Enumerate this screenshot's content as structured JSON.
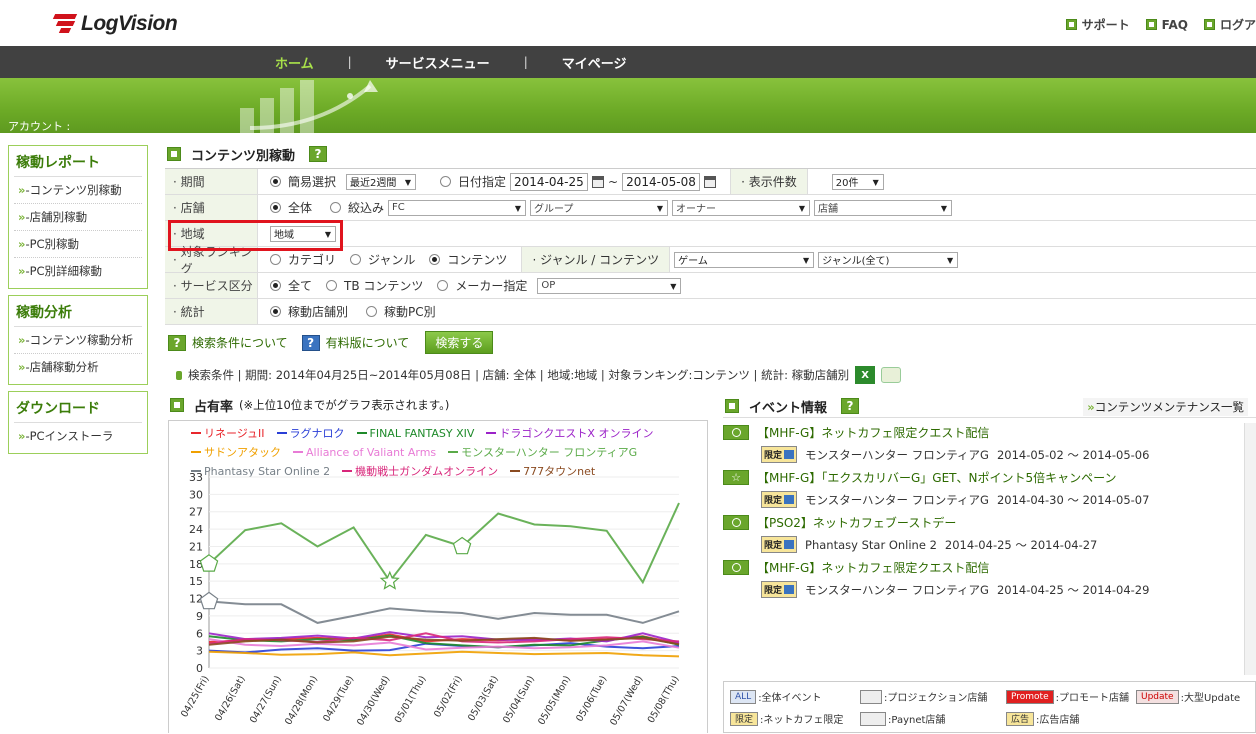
{
  "app": {
    "logo": "LogVision"
  },
  "toplinks": [
    {
      "label": "サポート"
    },
    {
      "label": "FAQ"
    },
    {
      "label": "ログア"
    }
  ],
  "nav": {
    "items": [
      "ホーム",
      "サービスメニュー",
      "マイページ"
    ],
    "sep": "|",
    "active": 0
  },
  "account_label": "アカウント :",
  "sidebar": [
    {
      "title": "稼動レポート",
      "items": [
        "-コンテンツ別稼動",
        "-店舗別稼動",
        "-PC別稼動",
        "-PC別詳細稼動"
      ]
    },
    {
      "title": "稼動分析",
      "items": [
        "-コンテンツ稼動分析",
        "-店舗稼動分析"
      ]
    },
    {
      "title": "ダウンロード",
      "items": [
        "-PCインストーラ"
      ]
    }
  ],
  "page_title": "コンテンツ別稼動",
  "form": {
    "period": {
      "label": "期間",
      "simple": "簡易選択",
      "simple_value": "最近2週間",
      "date_label": "日付指定",
      "from": "2014-04-25",
      "tilde": "~",
      "to": "2014-05-08",
      "count_label": "表示件数",
      "count_value": "20件"
    },
    "store": {
      "label": "店舗",
      "all": "全体",
      "filter": "絞込み",
      "s1": "FC",
      "s2": "グループ",
      "s3": "オーナー",
      "s4": "店舗"
    },
    "region": {
      "label": "地域",
      "value": "地域"
    },
    "ranking": {
      "label": "対象ランキング",
      "o1": "カテゴリ",
      "o2": "ジャンル",
      "o3": "コンテンツ",
      "sub_label": "ジャンル / コンテンツ",
      "s1": "ゲーム",
      "s2": "ジャンル(全て)"
    },
    "service": {
      "label": "サービス区分",
      "o1": "全て",
      "o2": "TB コンテンツ",
      "o3": "メーカー指定",
      "s1": "OP"
    },
    "stats": {
      "label": "統計",
      "o1": "稼動店舗別",
      "o2": "稼動PC別"
    }
  },
  "links": {
    "search_about": "検索条件について",
    "paid_about": "有料版について",
    "search_btn": "検索する"
  },
  "condition_text": "検索条件 | 期間: 2014年04月25日~2014年05月08日 | 店舗: 全体 | 地域:地域 | 対象ランキング:コンテンツ | 統計: 稼動店舗別",
  "share": {
    "title": "占有率",
    "note": "(※上位10位までがグラフ表示されます。)"
  },
  "chart_data": {
    "type": "line",
    "categories": [
      "04/25(Fri)",
      "04/26(Sat)",
      "04/27(Sun)",
      "04/28(Mon)",
      "04/29(Tue)",
      "04/30(Wed)",
      "05/01(Thu)",
      "05/02(Fri)",
      "05/03(Sat)",
      "05/04(Sun)",
      "05/05(Mon)",
      "05/06(Tue)",
      "05/07(Wed)",
      "05/08(Thu)"
    ],
    "yticks": [
      0,
      3,
      6,
      9,
      12,
      15,
      18,
      21,
      24,
      27,
      30,
      33
    ],
    "ylim": [
      0,
      33
    ],
    "series": [
      {
        "name": "リネージュII",
        "color": "#e8262c",
        "values": [
          4.5,
          4.8,
          5.0,
          5.2,
          4.9,
          5.8,
          4.6,
          5.0,
          4.8,
          5.1,
          4.7,
          5.0,
          5.5,
          4.2
        ]
      },
      {
        "name": "ラグナロク",
        "color": "#2a3fd6",
        "values": [
          3.0,
          2.7,
          3.2,
          3.4,
          3.0,
          3.1,
          4.2,
          3.8,
          3.6,
          3.9,
          4.3,
          3.7,
          3.4,
          3.8
        ]
      },
      {
        "name": "FINAL FANTASY XIV",
        "color": "#1e8a2a",
        "values": [
          5.5,
          4.8,
          4.6,
          5.0,
          4.8,
          5.6,
          4.3,
          3.9,
          3.6,
          4.0,
          3.9,
          4.8,
          5.4,
          4.0
        ]
      },
      {
        "name": "ドラゴンクエストX オンライン",
        "color": "#9b22c8",
        "values": [
          6.0,
          5.0,
          5.2,
          5.6,
          5.1,
          6.2,
          5.3,
          5.5,
          4.9,
          4.8,
          5.1,
          4.6,
          6.0,
          4.4
        ]
      },
      {
        "name": "サドンアタック",
        "color": "#f0a000",
        "values": [
          2.8,
          2.6,
          2.3,
          2.4,
          2.7,
          2.2,
          2.5,
          2.8,
          2.6,
          2.4,
          2.5,
          2.6,
          2.2,
          2.0
        ]
      },
      {
        "name": "Alliance of Valiant Arms",
        "color": "#e87bd6",
        "values": [
          5.0,
          4.0,
          3.8,
          4.2,
          3.9,
          4.4,
          3.2,
          3.5,
          3.7,
          3.4,
          3.6,
          3.9,
          4.6,
          3.5
        ]
      },
      {
        "name": "モンスターハンター フロンティアG",
        "color": "#5aaa48",
        "values": [
          18.0,
          23.8,
          25.0,
          21.0,
          24.3,
          15.0,
          23.0,
          21.0,
          26.7,
          24.8,
          24.5,
          23.7,
          14.8,
          28.5
        ]
      },
      {
        "name": "Phantasy Star Online 2",
        "color": "#778088",
        "values": [
          11.5,
          11.0,
          11.0,
          7.8,
          9.0,
          10.3,
          9.8,
          9.5,
          8.5,
          9.5,
          9.2,
          9.2,
          7.8,
          9.8
        ]
      },
      {
        "name": "機動戦士ガンダムオンライン",
        "color": "#d8267a",
        "values": [
          4.2,
          5.0,
          4.8,
          4.5,
          5.2,
          4.8,
          6.0,
          4.6,
          4.4,
          4.6,
          5.0,
          5.3,
          5.0,
          4.6
        ]
      },
      {
        "name": "777タウンnet",
        "color": "#8a4a20",
        "values": [
          4.0,
          4.6,
          4.9,
          4.4,
          4.6,
          5.4,
          4.9,
          4.7,
          5.0,
          5.2,
          4.7,
          4.9,
          5.2,
          4.1
        ]
      }
    ]
  },
  "events": {
    "title": "イベント情報",
    "maint_link": "コンテンツメンテナンス一覧",
    "items": [
      {
        "title": "【MHF-G】ネットカフェ限定クエスト配信",
        "badge": "限定",
        "game": "モンスターハンター フロンティアG",
        "dates": "2014-05-02 〜 2014-05-06"
      },
      {
        "title": "【MHF-G】「エクスカリバーG」GET、Nポイント5倍キャンペーン",
        "badge": "限定",
        "game": "モンスターハンター フロンティアG",
        "dates": "2014-04-30 〜 2014-05-07"
      },
      {
        "title": "【PSO2】ネットカフェブーストデー",
        "badge": "限定",
        "game": "Phantasy Star Online 2",
        "dates": "2014-04-25 〜 2014-04-27"
      },
      {
        "title": "【MHF-G】ネットカフェ限定クエスト配信",
        "badge": "限定",
        "game": "モンスターハンター フロンティアG",
        "dates": "2014-04-25 〜 2014-04-29"
      }
    ]
  },
  "keys": [
    {
      "badge": "ALL",
      "label": ":全体イベント"
    },
    {
      "badge": "",
      "label": ":プロジェクション店舗"
    },
    {
      "badge": "Promote",
      "label": ":プロモート店舗"
    },
    {
      "badge": "Update",
      "label": ":大型Update"
    },
    {
      "badge": "限定",
      "label": ":ネットカフェ限定"
    },
    {
      "badge": "",
      "label": ":Paynet店舗"
    },
    {
      "badge": "広告",
      "label": ":広告店舗"
    }
  ]
}
